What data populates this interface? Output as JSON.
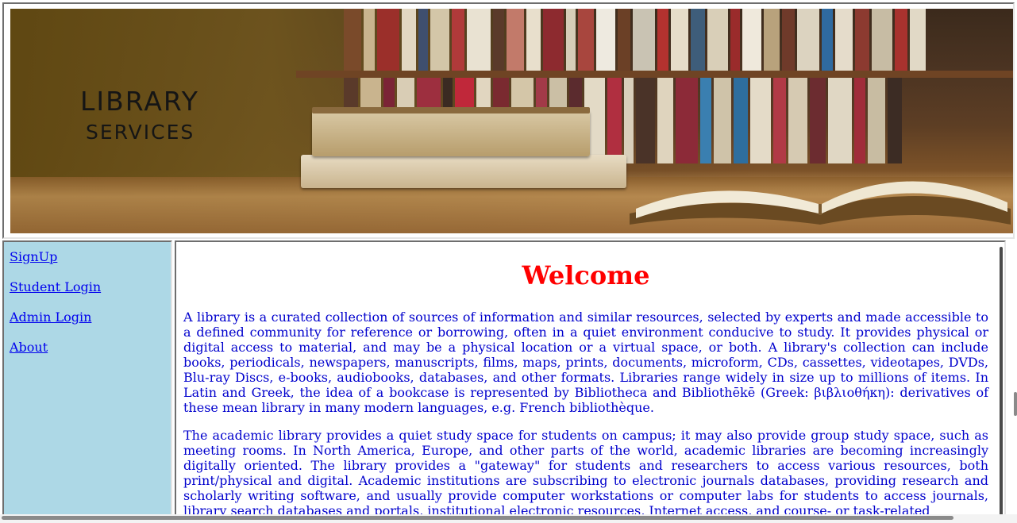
{
  "banner": {
    "title_line1": "LIBRARY",
    "title_line2": "SERVICES",
    "image": "library-bookshelf-photo"
  },
  "nav": {
    "items": [
      {
        "label": "SignUp"
      },
      {
        "label": "Student Login"
      },
      {
        "label": "Admin Login"
      },
      {
        "label": "About"
      }
    ]
  },
  "main": {
    "heading": "Welcome",
    "paragraphs": [
      "A library is a curated collection of sources of information and similar resources, selected by experts and made accessible to a defined community for reference or borrowing, often in a quiet environment conducive to study. It provides physical or digital access to material, and may be a physical location or a virtual space, or both. A library's collection can include books, periodicals, newspapers, manuscripts, films, maps, prints, documents, microform, CDs, cassettes, videotapes, DVDs, Blu-ray Discs, e-books, audiobooks, databases, and other formats. Libraries range widely in size up to millions of items. In Latin and Greek, the idea of a bookcase is represented by Bibliotheca and Bibliothēkē (Greek: βιβλιοθήκη): derivatives of these mean library in many modern languages, e.g. French bibliothèque.",
      "The academic library provides a quiet study space for students on campus; it may also provide group study space, such as meeting rooms. In North America, Europe, and other parts of the world, academic libraries are becoming increasingly digitally oriented. The library provides a \"gateway\" for students and researchers to access various resources, both print/physical and digital. Academic institutions are subscribing to electronic journals databases, providing research and scholarly writing software, and usually provide computer workstations or computer labs for students to access journals, library search databases and portals, institutional electronic resources, Internet access, and course- or task-related"
    ]
  },
  "colors": {
    "nav_background": "#add8e6",
    "link": "#0000ee",
    "heading": "#ff0000",
    "body_text": "#0000cd"
  }
}
